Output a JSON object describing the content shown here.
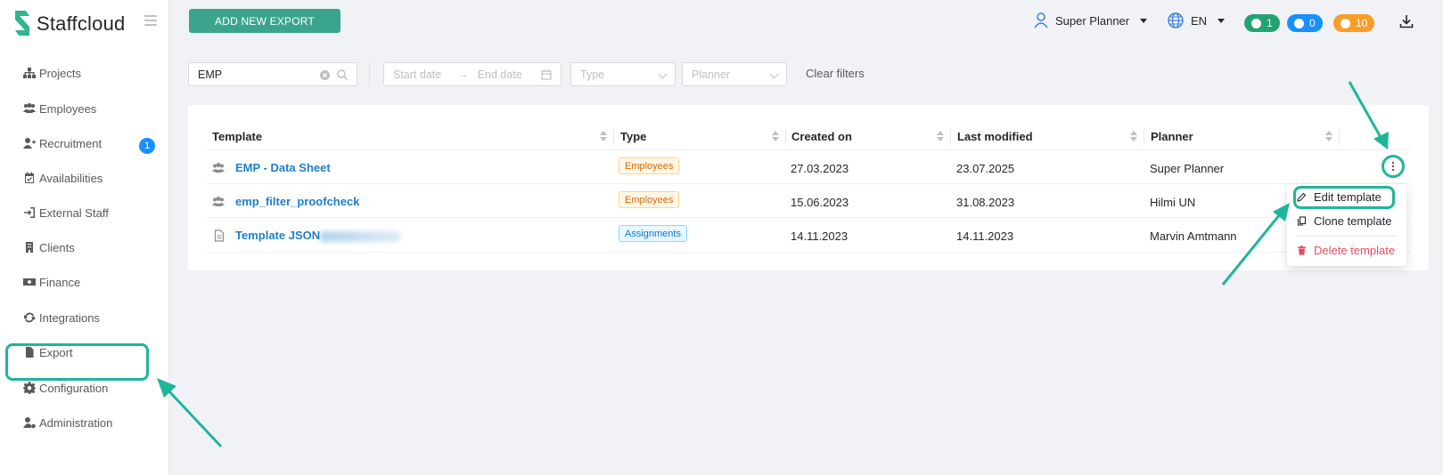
{
  "brand": {
    "name": "Staffcloud",
    "accent": "#3aa58c",
    "highlight": "#1fb59a"
  },
  "sidebar": {
    "items": [
      {
        "label": "Projects",
        "icon": "sitemap-icon"
      },
      {
        "label": "Employees",
        "icon": "users-icon"
      },
      {
        "label": "Recruitment",
        "icon": "user-plus-icon",
        "badge": "1"
      },
      {
        "label": "Availabilities",
        "icon": "calendar-check-icon"
      },
      {
        "label": "External Staff",
        "icon": "sign-in-icon"
      },
      {
        "label": "Clients",
        "icon": "building-icon"
      },
      {
        "label": "Finance",
        "icon": "money-icon"
      },
      {
        "label": "Integrations",
        "icon": "sync-icon"
      },
      {
        "label": "Export",
        "icon": "file-icon",
        "active": true
      },
      {
        "label": "Configuration",
        "icon": "gear-icon"
      },
      {
        "label": "Administration",
        "icon": "user-gear-icon"
      }
    ]
  },
  "header": {
    "add_button": "ADD NEW EXPORT",
    "user": "Super Planner",
    "language": "EN",
    "counters": {
      "messages": "1",
      "notifications": "0",
      "warnings": "10"
    }
  },
  "filters": {
    "search_value": "EMP",
    "start_date": "Start date",
    "end_date": "End date",
    "type": "Type",
    "planner": "Planner",
    "clear": "Clear filters"
  },
  "table": {
    "columns": [
      "Template",
      "Type",
      "Created on",
      "Last modified",
      "Planner"
    ],
    "rows": [
      {
        "template": "EMP - Data Sheet",
        "icon": "users-icon",
        "type": "Employees",
        "created": "27.03.2023",
        "modified": "23.07.2025",
        "planner": "Super Planner"
      },
      {
        "template": "emp_filter_proofcheck",
        "icon": "users-icon",
        "type": "Employees",
        "created": "15.06.2023",
        "modified": "31.08.2023",
        "planner": "Hilmi UN"
      },
      {
        "template": "Template JSON",
        "icon": "file-icon",
        "type": "Assignments",
        "created": "14.11.2023",
        "modified": "14.11.2023",
        "planner": "Marvin Amtmann"
      }
    ]
  },
  "menu": {
    "edit": "Edit template",
    "clone": "Clone template",
    "delete": "Delete template"
  }
}
